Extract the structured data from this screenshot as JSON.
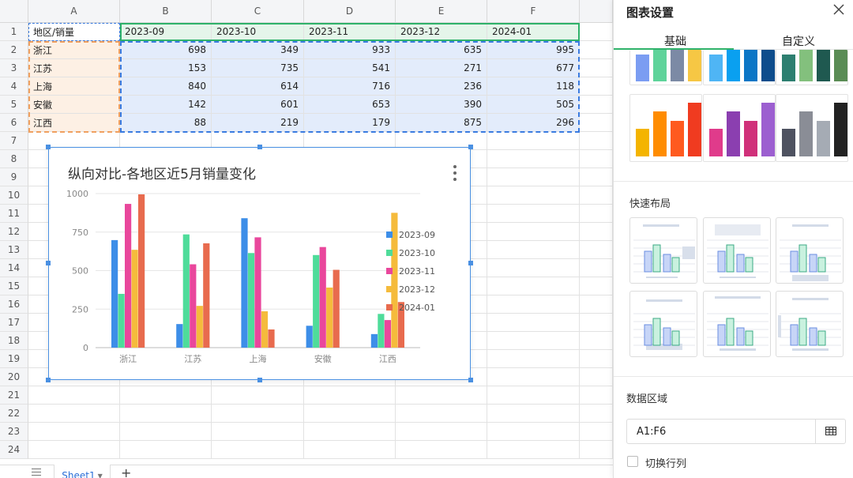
{
  "sheet": {
    "columns": [
      "A",
      "B",
      "C",
      "D",
      "E",
      "F"
    ],
    "rows": [
      "1",
      "2",
      "3",
      "4",
      "5",
      "6",
      "7",
      "8",
      "9",
      "10",
      "11",
      "12",
      "13",
      "14",
      "15",
      "16",
      "17",
      "18",
      "19",
      "20",
      "21",
      "22",
      "23",
      "24"
    ],
    "header": [
      "地区/销量",
      "2023-09",
      "2023-10",
      "2023-11",
      "2023-12",
      "2024-01"
    ],
    "data": [
      [
        "浙江",
        "698",
        "349",
        "933",
        "635",
        "995"
      ],
      [
        "江苏",
        "153",
        "735",
        "541",
        "271",
        "677"
      ],
      [
        "上海",
        "840",
        "614",
        "716",
        "236",
        "118"
      ],
      [
        "安徽",
        "142",
        "601",
        "653",
        "390",
        "505"
      ],
      [
        "江西",
        "88",
        "219",
        "179",
        "875",
        "296"
      ]
    ]
  },
  "chart": {
    "title": "纵向对比-各地区近5月销量变化",
    "menu_icon": "more-vertical-icon"
  },
  "chart_data": {
    "type": "bar",
    "title": "纵向对比-各地区近5月销量变化",
    "categories": [
      "浙江",
      "江苏",
      "上海",
      "安徽",
      "江西"
    ],
    "series": [
      {
        "name": "2023-09",
        "color": "#3d8ee8",
        "values": [
          698,
          153,
          840,
          142,
          88
        ]
      },
      {
        "name": "2023-10",
        "color": "#4fdc9a",
        "values": [
          349,
          735,
          614,
          601,
          219
        ]
      },
      {
        "name": "2023-11",
        "color": "#e9479c",
        "values": [
          933,
          541,
          716,
          653,
          179
        ]
      },
      {
        "name": "2023-12",
        "color": "#f5bb3c",
        "values": [
          635,
          271,
          236,
          390,
          875
        ]
      },
      {
        "name": "2024-01",
        "color": "#e86b4e",
        "values": [
          995,
          677,
          118,
          505,
          296
        ]
      }
    ],
    "ylim": [
      0,
      1000
    ],
    "yticks": [
      "0",
      "250",
      "500",
      "750",
      "1000"
    ],
    "grid": true,
    "legend": "right"
  },
  "tabs": {
    "list_icon": "list-icon",
    "sheet_name": "Sheet1",
    "sheet_dropdown_icon": "caret-down-icon",
    "add": "+"
  },
  "panel": {
    "title": "图表设置",
    "close_icon": "close-icon",
    "tab_basic": "基础",
    "tab_custom": "自定义",
    "palettes_top": [
      [
        "#7b9df2",
        "#5ed39a",
        "#7c8aa5",
        "#f6c744"
      ],
      [
        "#4fb5f5",
        "#0aa0f0",
        "#0b76c6",
        "#0e4d8c"
      ],
      [
        "#2d7f70",
        "#83c07d",
        "#1f5950",
        "#5a8c55"
      ]
    ],
    "palettes": [
      [
        "#f4b400",
        "#ff8c00",
        "#ff5a1f",
        "#f03b20"
      ],
      [
        "#e03b8b",
        "#8b3fb0",
        "#d0307a",
        "#9c5fd0"
      ],
      [
        "#4e5260",
        "#8a8d96",
        "#a5abb4",
        "#222222"
      ]
    ],
    "quick_layout_title": "快速布局",
    "data_range_title": "数据区域",
    "data_range_value": "A1:F6",
    "range_icon": "table-select-icon",
    "switch_label": "切换行列",
    "accent": "#2fb26a"
  }
}
